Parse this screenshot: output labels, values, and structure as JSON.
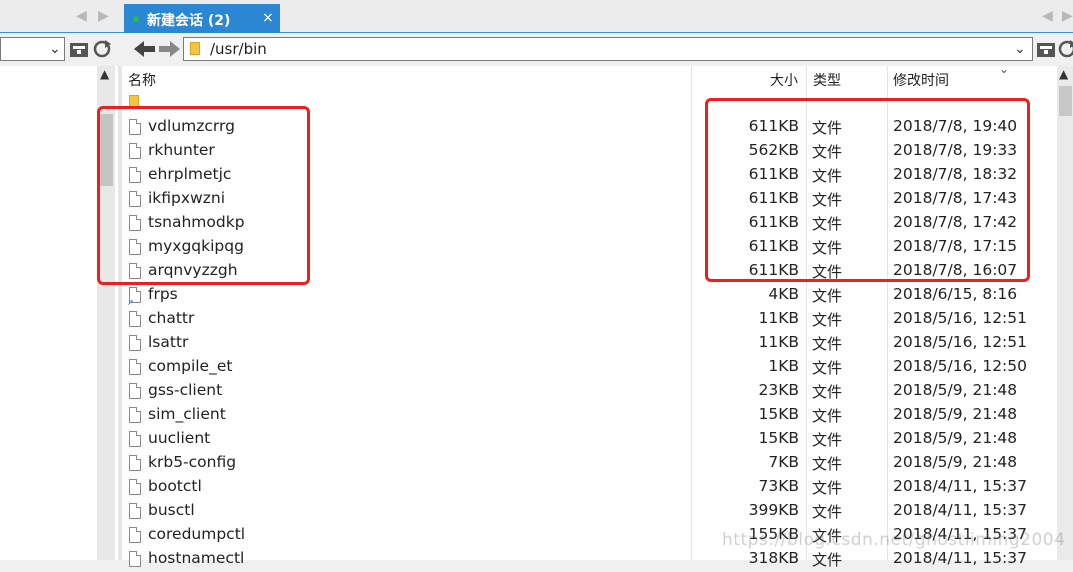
{
  "tabs": [
    {
      "label": "新建会话 (2)",
      "close": "×",
      "active": true
    }
  ],
  "path": {
    "value": "/usr/bin"
  },
  "columns": {
    "name": "名称",
    "size": "大小",
    "type": "类型",
    "modified": "修改时间"
  },
  "files": [
    {
      "name": "vdlumzcrrg",
      "size": "611KB",
      "type": "文件",
      "modified": "2018/7/8, 19:40"
    },
    {
      "name": "rkhunter",
      "size": "562KB",
      "type": "文件",
      "modified": "2018/7/8, 19:33"
    },
    {
      "name": "ehrplmetjc",
      "size": "611KB",
      "type": "文件",
      "modified": "2018/7/8, 18:32"
    },
    {
      "name": "ikfipxwzni",
      "size": "611KB",
      "type": "文件",
      "modified": "2018/7/8, 17:43"
    },
    {
      "name": "tsnahmodkp",
      "size": "611KB",
      "type": "文件",
      "modified": "2018/7/8, 17:42"
    },
    {
      "name": "myxgqkipqg",
      "size": "611KB",
      "type": "文件",
      "modified": "2018/7/8, 17:15"
    },
    {
      "name": "arqnvyzzgh",
      "size": "611KB",
      "type": "文件",
      "modified": "2018/7/8, 16:07"
    },
    {
      "name": "frps",
      "size": "4KB",
      "type": "文件",
      "modified": "2018/6/15, 8:16"
    },
    {
      "name": "chattr",
      "size": "11KB",
      "type": "文件",
      "modified": "2018/5/16, 12:51"
    },
    {
      "name": "lsattr",
      "size": "11KB",
      "type": "文件",
      "modified": "2018/5/16, 12:51"
    },
    {
      "name": "compile_et",
      "size": "1KB",
      "type": "文件",
      "modified": "2018/5/16, 12:50"
    },
    {
      "name": "gss-client",
      "size": "23KB",
      "type": "文件",
      "modified": "2018/5/9, 21:48"
    },
    {
      "name": "sim_client",
      "size": "15KB",
      "type": "文件",
      "modified": "2018/5/9, 21:48"
    },
    {
      "name": "uuclient",
      "size": "15KB",
      "type": "文件",
      "modified": "2018/5/9, 21:48"
    },
    {
      "name": "krb5-config",
      "size": "7KB",
      "type": "文件",
      "modified": "2018/5/9, 21:48"
    },
    {
      "name": "bootctl",
      "size": "73KB",
      "type": "文件",
      "modified": "2018/4/11, 15:37"
    },
    {
      "name": "busctl",
      "size": "399KB",
      "type": "文件",
      "modified": "2018/4/11, 15:37"
    },
    {
      "name": "coredumpctl",
      "size": "155KB",
      "type": "文件",
      "modified": "2018/4/11, 15:37"
    },
    {
      "name": "hostnamectl",
      "size": "318KB",
      "type": "文件",
      "modified": "2018/4/11, 15:37"
    }
  ],
  "watermark": "https://blog.csdn.net/ghostliming2004",
  "colors": {
    "tab_active": "#2b86d3",
    "annotation_red": "#e82020",
    "status_dot": "#22c048"
  },
  "icons": [
    "back-arrow-icon",
    "forward-arrow-icon",
    "folder-icon",
    "refresh-icon",
    "bookmark-icon",
    "file-icon",
    "link-file-icon"
  ]
}
